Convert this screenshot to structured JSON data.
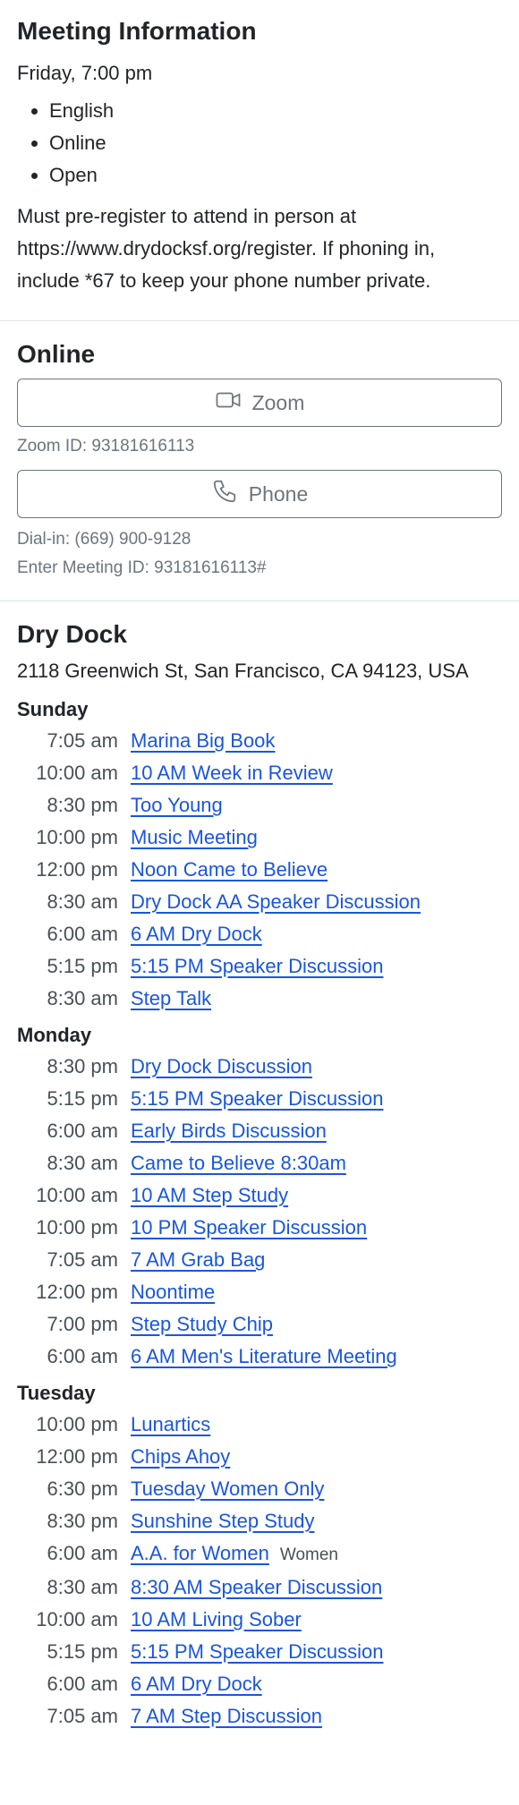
{
  "info": {
    "title": "Meeting Information",
    "when": "Friday, 7:00 pm",
    "types": [
      "English",
      "Online",
      "Open"
    ],
    "notes": "Must pre-register to attend in person at https://www.drydocksf.org/register. If phoning in, include *67 to keep your phone number private."
  },
  "online": {
    "title": "Online",
    "zoom_label": "Zoom",
    "zoom_id": "Zoom ID: 93181616113",
    "phone_label": "Phone",
    "dial_in": "Dial-in: (669) 900-9128",
    "meeting_id": "Enter Meeting ID: 93181616113#",
    "icons": {
      "zoom": "video-camera-icon",
      "phone": "phone-icon"
    }
  },
  "location": {
    "title": "Dry Dock",
    "address": "2118 Greenwich St, San Francisco, CA 94123, USA",
    "link_color": "#1a56db",
    "days": [
      {
        "name": "Sunday",
        "meetings": [
          {
            "time": "7:05 am",
            "name": "Marina Big Book"
          },
          {
            "time": "10:00 am",
            "name": "10 AM Week in Review"
          },
          {
            "time": "8:30 pm",
            "name": "Too Young"
          },
          {
            "time": "10:00 pm",
            "name": "Music Meeting"
          },
          {
            "time": "12:00 pm",
            "name": "Noon Came to Believe"
          },
          {
            "time": "8:30 am",
            "name": "Dry Dock AA Speaker Discussion"
          },
          {
            "time": "6:00 am",
            "name": "6 AM Dry Dock"
          },
          {
            "time": "5:15 pm",
            "name": "5:15 PM Speaker Discussion"
          },
          {
            "time": "8:30 am",
            "name": "Step Talk"
          }
        ]
      },
      {
        "name": "Monday",
        "meetings": [
          {
            "time": "8:30 pm",
            "name": "Dry Dock Discussion"
          },
          {
            "time": "5:15 pm",
            "name": "5:15 PM Speaker Discussion"
          },
          {
            "time": "6:00 am",
            "name": "Early Birds Discussion"
          },
          {
            "time": "8:30 am",
            "name": "Came to Believe 8:30am"
          },
          {
            "time": "10:00 am",
            "name": "10 AM Step Study"
          },
          {
            "time": "10:00 pm",
            "name": "10 PM Speaker Discussion"
          },
          {
            "time": "7:05 am",
            "name": "7 AM Grab Bag"
          },
          {
            "time": "12:00 pm",
            "name": "Noontime"
          },
          {
            "time": "7:00 pm",
            "name": "Step Study Chip"
          },
          {
            "time": "6:00 am",
            "name": "6 AM Men's Literature Meeting"
          }
        ]
      },
      {
        "name": "Tuesday",
        "meetings": [
          {
            "time": "10:00 pm",
            "name": "Lunartics"
          },
          {
            "time": "12:00 pm",
            "name": "Chips Ahoy"
          },
          {
            "time": "6:30 pm",
            "name": "Tuesday Women Only"
          },
          {
            "time": "8:30 pm",
            "name": "Sunshine Step Study"
          },
          {
            "time": "6:00 am",
            "name": "A.A. for Women",
            "tag": "Women"
          },
          {
            "time": "8:30 am",
            "name": "8:30 AM Speaker Discussion"
          },
          {
            "time": "10:00 am",
            "name": "10 AM Living Sober"
          },
          {
            "time": "5:15 pm",
            "name": "5:15 PM Speaker Discussion"
          },
          {
            "time": "6:00 am",
            "name": "6 AM Dry Dock"
          },
          {
            "time": "7:05 am",
            "name": "7 AM Step Discussion"
          }
        ]
      }
    ]
  }
}
